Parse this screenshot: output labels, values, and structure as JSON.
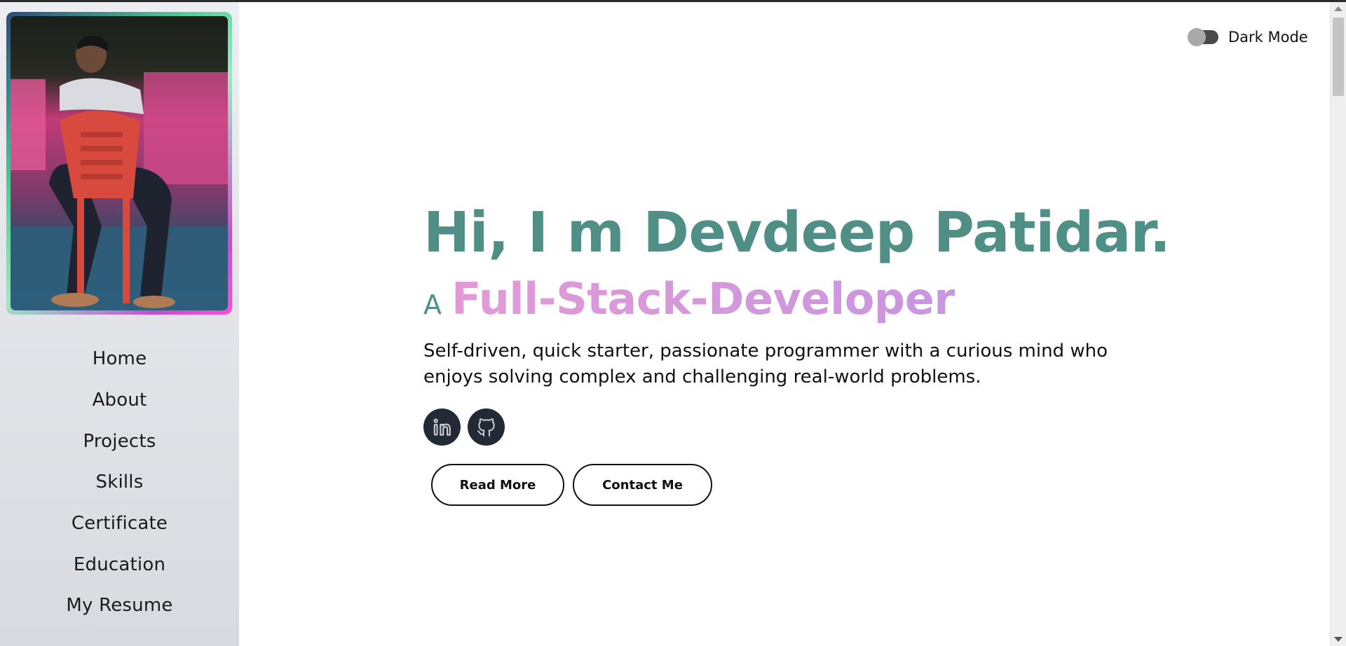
{
  "sidebar": {
    "nav": [
      "Home",
      "About",
      "Projects",
      "Skills",
      "Certificate",
      "Education",
      "My Resume"
    ]
  },
  "header": {
    "dark_mode_label": "Dark Mode",
    "dark_mode_on": false
  },
  "hero": {
    "title": "Hi, I m Devdeep Patidar.",
    "prefix": "A",
    "role": "Full-Stack-Developer",
    "description": "Self-driven, quick starter, passionate programmer with a curious mind who enjoys solving complex and challenging real-world problems.",
    "socials": [
      "linkedin-icon",
      "github-icon"
    ],
    "buttons": {
      "read_more": "Read More",
      "contact_me": "Contact Me"
    }
  },
  "colors": {
    "accent": "#4f8f86",
    "role_gradient_start": "#e29ad6",
    "role_gradient_end": "#c896e0",
    "social_bg": "#222a36"
  }
}
